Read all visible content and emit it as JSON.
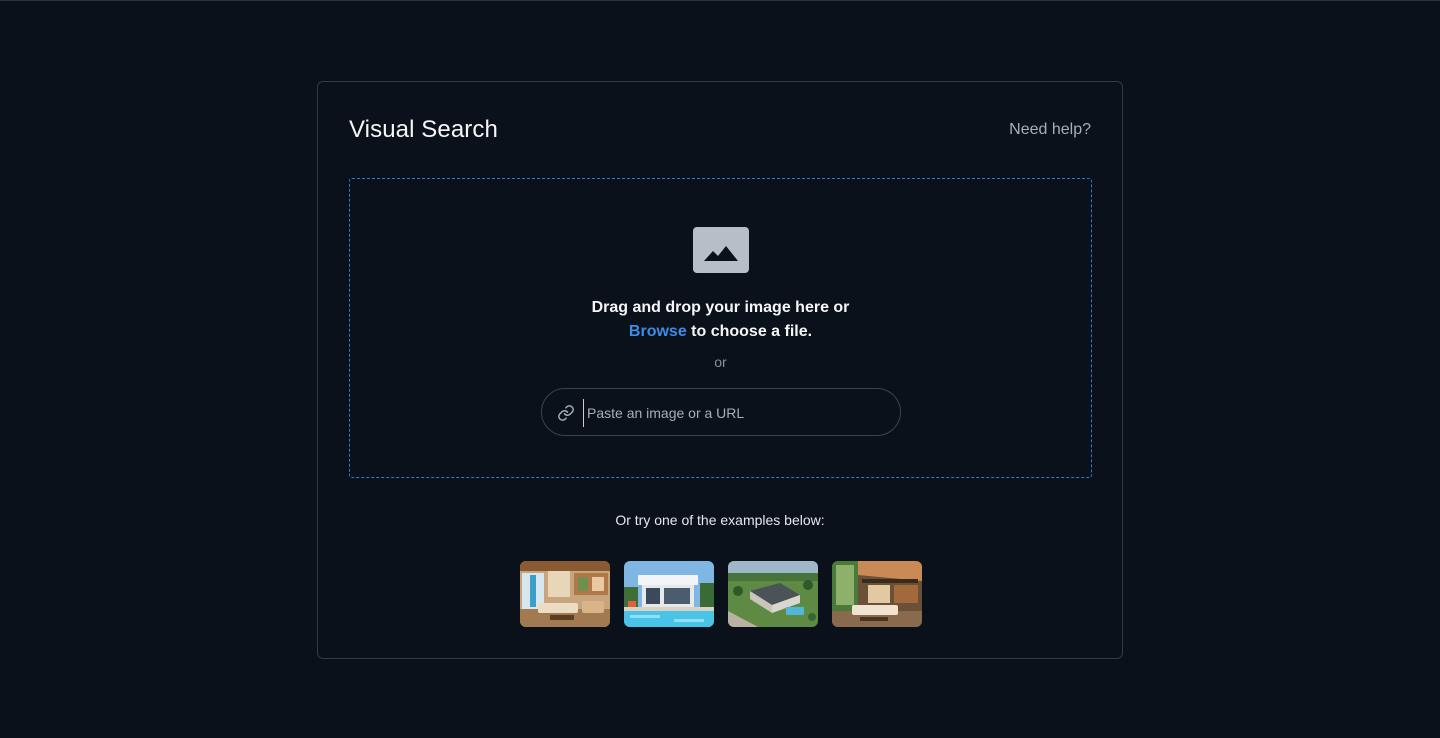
{
  "card": {
    "title": "Visual Search",
    "help_label": "Need help?"
  },
  "dropzone": {
    "line1": "Drag and drop your image here or",
    "browse_label": "Browse",
    "line2_rest": " to choose a file.",
    "or_label": "or",
    "url_placeholder": "Paste an image or a URL",
    "icons": {
      "main": "image-icon",
      "url": "link-icon"
    },
    "accent_color": "#3d8ce8"
  },
  "examples": {
    "label": "Or try one of the examples below:",
    "items": [
      {
        "name": "example-living-room"
      },
      {
        "name": "example-pool-house"
      },
      {
        "name": "example-aerial-house"
      },
      {
        "name": "example-atrium-interior"
      }
    ]
  }
}
